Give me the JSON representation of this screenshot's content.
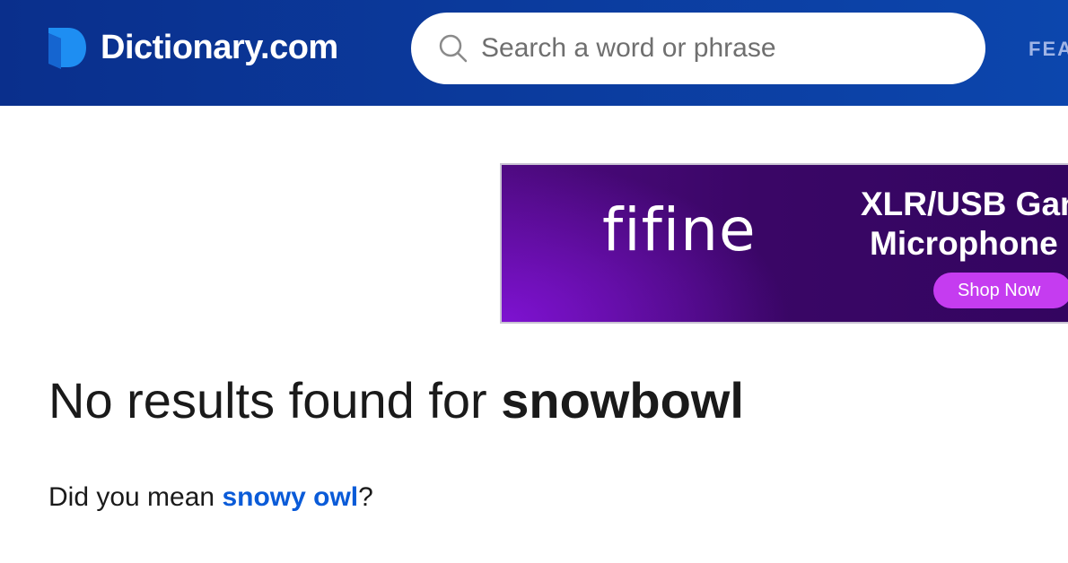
{
  "header": {
    "logo_text": "Dictionary.com",
    "nav_partial": "FEA",
    "colors": {
      "background": "#0b3a9c",
      "logo_mark": "#1e8ef2"
    }
  },
  "search": {
    "placeholder": "Search a word or phrase",
    "value": "",
    "icon": "search-icon"
  },
  "ad": {
    "brand": "fifine",
    "headline_line1": "XLR/USB Gan",
    "headline_line2": "Microphone",
    "cta": "Shop Now",
    "colors": {
      "background": "#3a0666",
      "cta": "#c53cf0"
    }
  },
  "result": {
    "prefix": "No results found for ",
    "term": "snowbowl"
  },
  "suggestion": {
    "prefix": "Did you mean ",
    "link": "snowy owl",
    "suffix": "?",
    "link_color": "#0a5bd8"
  }
}
